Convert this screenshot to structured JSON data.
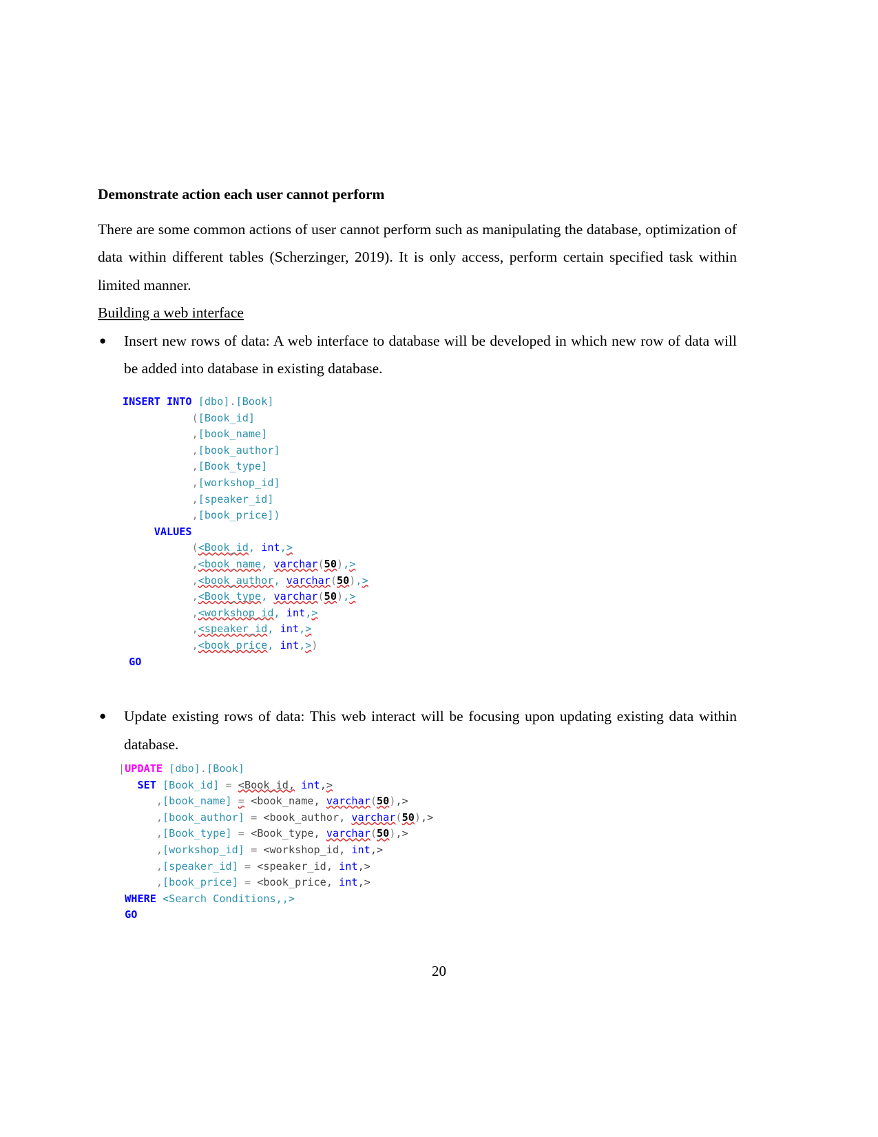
{
  "document": {
    "page_number": "20",
    "heading": "Demonstrate action each user cannot perform",
    "paragraph_1": "There are some common actions of user cannot perform such as manipulating the database, optimization of data within different tables (Scherzinger, 2019). It is only access, perform certain specified task within limited manner.",
    "subheading": "Building a web interface",
    "bullets": [
      {
        "text": "Insert new rows of data: A web interface to database will be developed in which new row of data will be added into database in existing database."
      },
      {
        "text": "Update existing rows of data: This web interact will be focusing upon updating existing data within database."
      }
    ]
  },
  "code_block_insert": {
    "name": "sql-insert-statement",
    "lines": [
      "INSERT INTO [dbo].[Book]",
      "           ([Book_id]",
      "           ,[book_name]",
      "           ,[book_author]",
      "           ,[Book_type]",
      "           ,[workshop_id]",
      "           ,[speaker_id]",
      "           ,[book_price])",
      "     VALUES",
      "           (<Book_id, int,>",
      "           ,<book_name, varchar(50),>",
      "           ,<book_author, varchar(50),>",
      "           ,<Book_type, varchar(50),>",
      "           ,<workshop_id, int,>",
      "           ,<speaker_id, int,>",
      "           ,<book_price, int,>)",
      "GO"
    ],
    "keywords": [
      "INSERT",
      "INTO",
      "VALUES",
      "GO",
      "int",
      "varchar"
    ]
  },
  "code_block_update": {
    "name": "sql-update-statement",
    "lines": [
      "UPDATE [dbo].[Book]",
      "   SET [Book_id] = <Book_id, int,>",
      "      ,[book_name] = <book_name, varchar(50),>",
      "      ,[book_author] = <book_author, varchar(50),>",
      "      ,[Book_type] = <Book_type, varchar(50),>",
      "      ,[workshop_id] = <workshop_id, int,>",
      "      ,[speaker_id] = <speaker_id, int,>",
      "      ,[book_price] = <book_price, int,>",
      " WHERE <Search Conditions,,>",
      "GO"
    ],
    "keywords": [
      "UPDATE",
      "SET",
      "WHERE",
      "GO",
      "int",
      "varchar"
    ]
  },
  "colors": {
    "keyword_blue": "#0000ff",
    "keyword_pink": "#ff00ff",
    "identifier_teal": "#2b91af",
    "punctuation_gray": "#808080",
    "spellcheck_red": "#e03030",
    "text_black": "#000000"
  }
}
